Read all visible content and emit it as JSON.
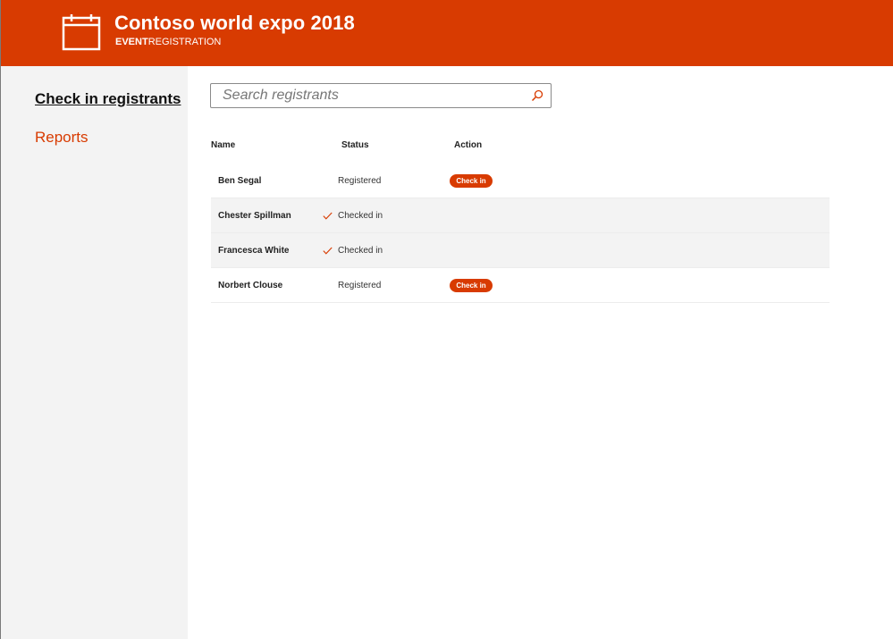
{
  "colors": {
    "accent": "#D83B01",
    "sidebar_bg": "#f3f3f3",
    "row_shaded": "#f3f3f3"
  },
  "header": {
    "icon": "calendar-icon",
    "title": "Contoso world expo 2018",
    "subtitle_strong": "EVENT",
    "subtitle_light": "REGISTRATION"
  },
  "sidebar": {
    "items": [
      {
        "label": "Check in registrants",
        "active": true
      },
      {
        "label": "Reports",
        "active": false
      }
    ]
  },
  "search": {
    "placeholder": "Search registrants",
    "value": "",
    "icon": "search-icon"
  },
  "table": {
    "columns": {
      "name": "Name",
      "status": "Status",
      "action": "Action"
    },
    "rows": [
      {
        "name": "Ben Segal",
        "status": "Registered",
        "action": "Check in"
      },
      {
        "name": "Chester Spillman",
        "status": "Checked in",
        "action": ""
      },
      {
        "name": "Francesca White",
        "status": "Checked in",
        "action": ""
      },
      {
        "name": "Norbert Clouse",
        "status": "Registered",
        "action": "Check in"
      }
    ]
  }
}
